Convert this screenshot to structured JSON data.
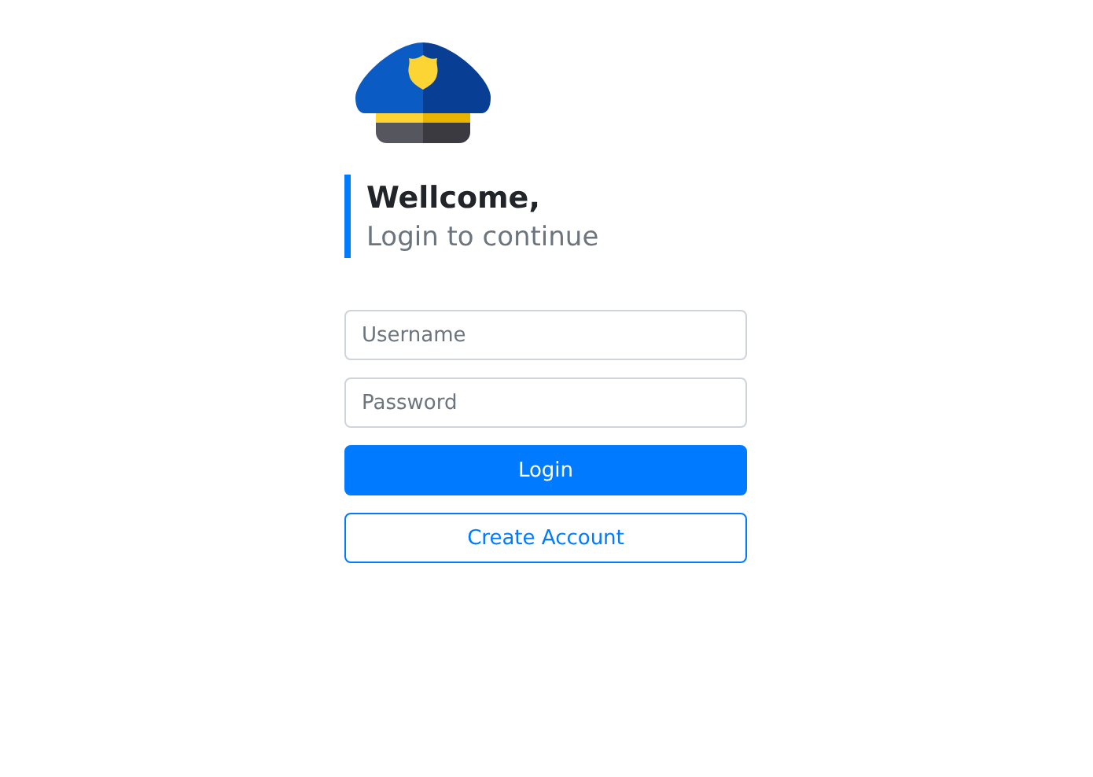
{
  "heading": {
    "title": "Wellcome,",
    "subtitle": "Login to continue"
  },
  "fields": [
    {
      "placeholder": "Username"
    },
    {
      "placeholder": "Password"
    }
  ],
  "buttons": [
    {
      "label": "Login",
      "kind": "primary"
    },
    {
      "label": "Create Account",
      "kind": "outline"
    }
  ]
}
